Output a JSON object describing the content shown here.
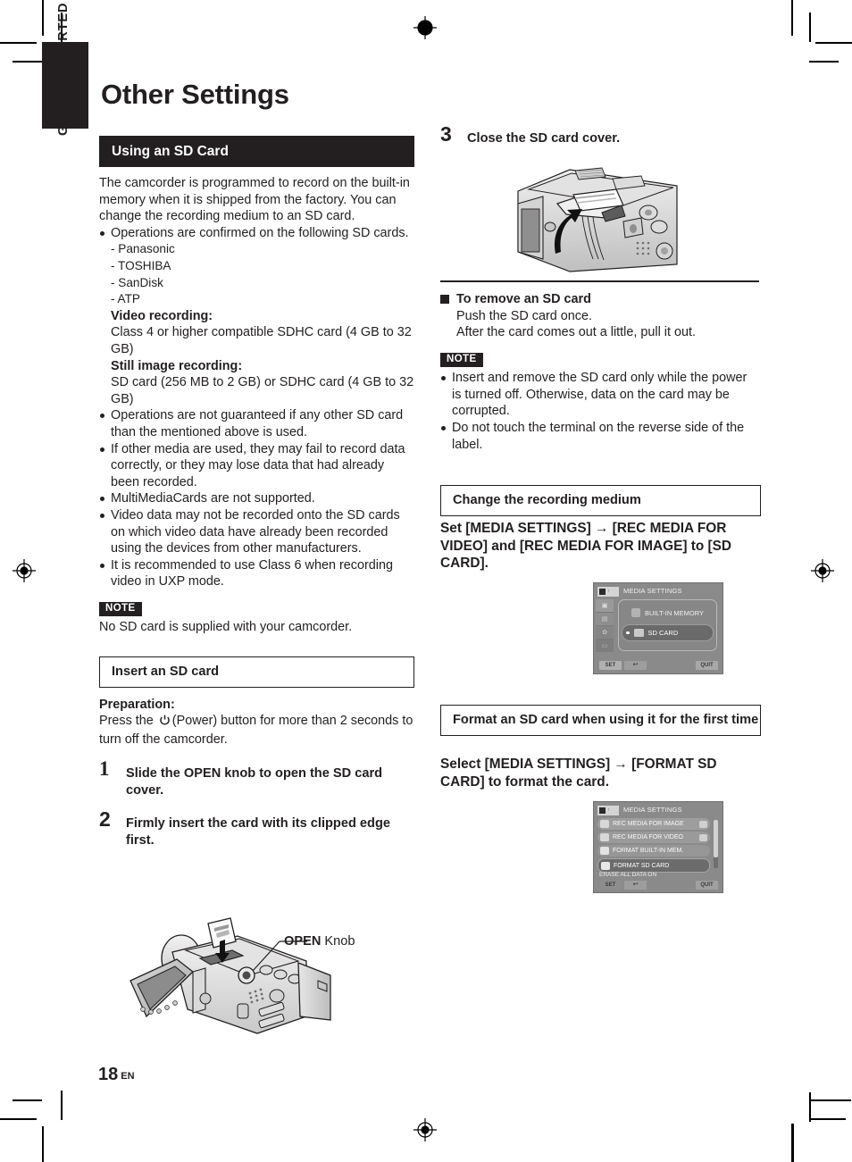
{
  "sidebar": {
    "tab_label": "GETTING STARTED"
  },
  "page_title": "Other Settings",
  "page_number": {
    "number": "18",
    "language": "EN"
  },
  "left_column": {
    "section_bar": "Using an SD Card",
    "intro": "The camcorder is programmed to record on the built-in memory when it is shipped from the factory. You can change the recording medium to an SD card.",
    "bullet_confirmed": "Operations are confirmed on the following SD cards.",
    "card_brands": [
      "- Panasonic",
      "- TOSHIBA",
      "- SanDisk",
      "- ATP"
    ],
    "video_recording_label": "Video recording:",
    "video_recording_text": "Class 4 or higher compatible SDHC card (4 GB to 32 GB)",
    "still_image_label": "Still image recording:",
    "still_image_text": "SD card (256 MB to 2 GB) or SDHC card (4 GB to 32 GB)",
    "bullets": [
      "Operations are not guaranteed if any other SD card than the mentioned above is used.",
      "If other media are used, they may fail to record data correctly, or they may lose data that had already been recorded.",
      "MultiMediaCards are not supported.",
      "Video data may not be recorded onto the SD cards on which video data have already been recorded using the devices from other manufacturers.",
      "It is recommended to use Class 6 when recording video in UXP mode."
    ],
    "note_badge": "NOTE",
    "note_text": "No SD card is supplied with your camcorder.",
    "insert_box": "Insert an SD card",
    "preparation_label": "Preparation:",
    "preparation_text_1": "Press the",
    "preparation_text_2": "(Power) button for more than 2 seconds to turn off the camcorder.",
    "steps": [
      {
        "num": "1",
        "text": "Slide the OPEN knob to open the SD card cover."
      },
      {
        "num": "2",
        "text": "Firmly insert the card with its clipped edge first."
      }
    ],
    "callout_bold": "OPEN",
    "callout_rest": " Knob"
  },
  "right_column": {
    "step3": {
      "num": "3",
      "text": "Close the SD card cover."
    },
    "remove_heading": "To remove an SD card",
    "remove_line_1": "Push the SD card once.",
    "remove_line_2": "After the card comes out a little, pull it out.",
    "note_badge": "NOTE",
    "note_bullets": [
      "Insert and remove the SD card only while the power is turned off. Otherwise, data on the card may be corrupted.",
      "Do not touch the terminal on the reverse side of the label."
    ],
    "change_medium_box": "Change the recording medium",
    "change_medium_instruction": "Set [MEDIA SETTINGS] → [REC MEDIA FOR VIDEO] and [REC MEDIA FOR IMAGE] to [SD CARD].",
    "format_box": "Format an SD card when using it for the first time",
    "format_instruction": "Select [MEDIA SETTINGS] → [FORMAT SD CARD] to format the card."
  },
  "lcd_screens": {
    "media_settings_select": {
      "title": "MEDIA SETTINGS",
      "options": [
        {
          "label": "BUILT-IN MEMORY",
          "selected": false
        },
        {
          "label": "SD CARD",
          "selected": true
        }
      ],
      "buttons": {
        "set": "SET",
        "back": "↩",
        "quit": "QUIT"
      }
    },
    "media_settings_menu": {
      "title": "MEDIA SETTINGS",
      "rows": [
        {
          "label": "REC MEDIA FOR IMAGE",
          "highlighted": false
        },
        {
          "label": "REC MEDIA FOR VIDEO",
          "highlighted": false
        },
        {
          "label": "FORMAT BUILT-IN MEM.",
          "highlighted": false
        },
        {
          "label": "FORMAT SD CARD",
          "highlighted": true
        }
      ],
      "status": "ERASE ALL DATA ON",
      "buttons": {
        "set": "SET",
        "back": "↩",
        "quit": "QUIT"
      }
    }
  },
  "colors": {
    "ink": "#231f20",
    "paper": "#ffffff",
    "lcd_bg": "#808080"
  }
}
